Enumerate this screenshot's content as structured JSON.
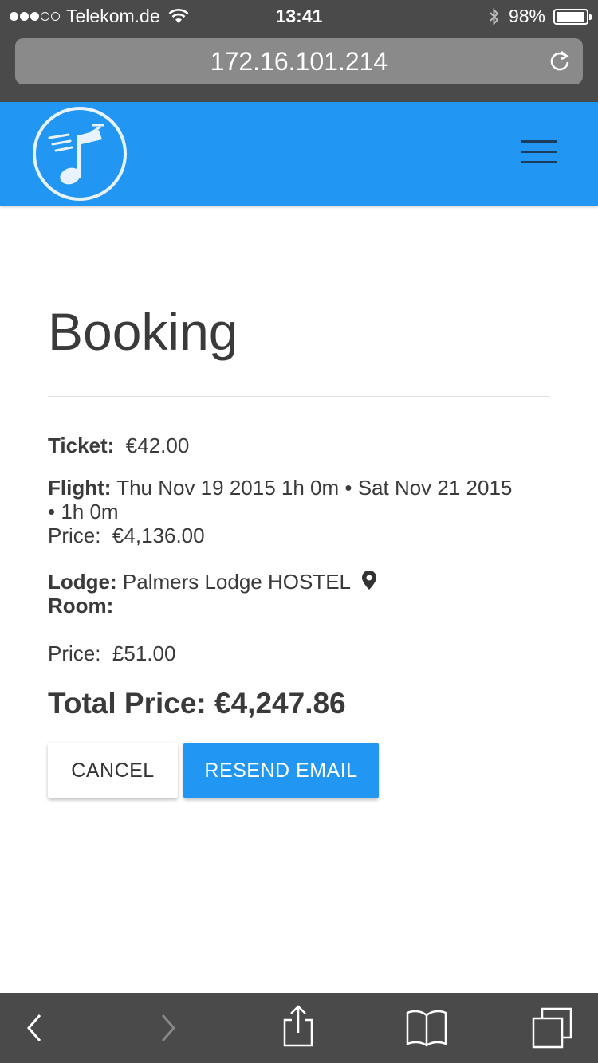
{
  "status_bar": {
    "carrier": "Telekom.de",
    "time": "13:41",
    "battery": "98%",
    "battery_level": 0.98,
    "signal_bars": 3,
    "signal_total": 5,
    "icons": [
      "wifi-icon",
      "bluetooth-icon",
      "battery-icon"
    ]
  },
  "browser": {
    "url": "172.16.101.214",
    "icons": [
      "reload-icon",
      "back-icon",
      "forward-icon",
      "share-icon",
      "bookmarks-icon",
      "tabs-icon"
    ]
  },
  "header": {
    "logo_icon": "music-note-logo-icon",
    "menu_icon": "hamburger-menu-icon",
    "color": "#2196f3"
  },
  "page": {
    "title": "Booking",
    "ticket": {
      "label": "Ticket:",
      "value": "€42.00"
    },
    "flight": {
      "label": "Flight:",
      "line1": "Thu Nov 19 2015 1h 0m • Sat Nov 21 2015",
      "line2": "• 1h 0m",
      "price_label": "Price:",
      "price": "€4,136.00"
    },
    "lodge": {
      "label": "Lodge:",
      "name": "Palmers Lodge HOSTEL",
      "location_icon": "map-pin-icon",
      "room_label": "Room:",
      "room_value": "",
      "price_label": "Price:",
      "price": "£51.00"
    },
    "total": "Total Price: €4,247.86",
    "buttons": {
      "cancel": "CANCEL",
      "resend": "RESEND EMAIL"
    }
  }
}
